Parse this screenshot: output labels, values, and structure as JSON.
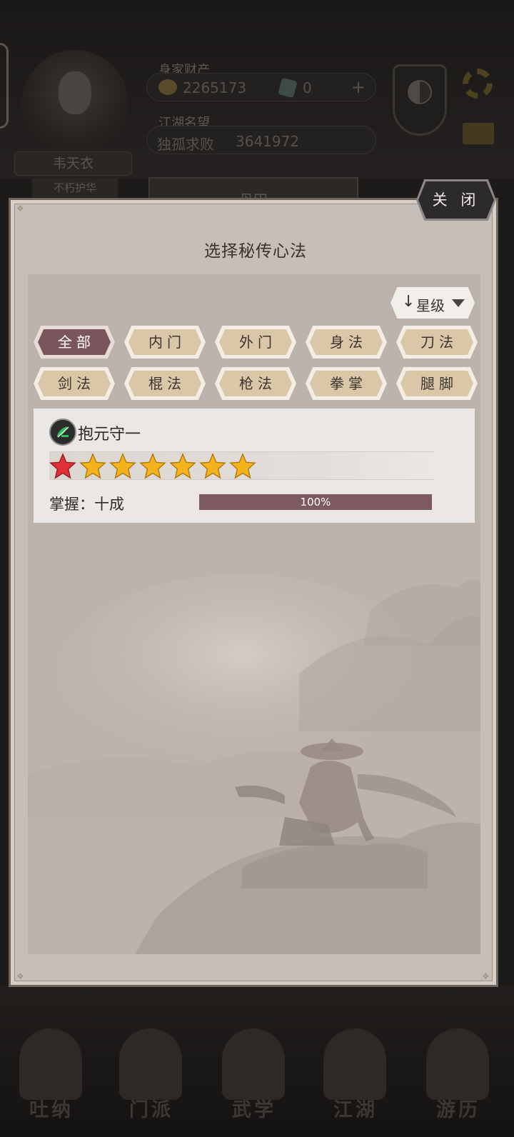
{
  "background": {
    "player": {
      "name": "韦天衣",
      "rank": "不朽护华"
    },
    "assets": {
      "label": "身家财产",
      "gold": "2265173",
      "gems": "0",
      "add_symbol": "+"
    },
    "reputation": {
      "label": "江湖名望",
      "title": "独孤求败",
      "value": "3641972"
    },
    "tab_label": "丹田",
    "nav": [
      {
        "label": "吐纳",
        "icon": "meditation-icon"
      },
      {
        "label": "门派",
        "icon": "sect-icon"
      },
      {
        "label": "武学",
        "icon": "martial-arts-icon"
      },
      {
        "label": "江湖",
        "icon": "jianghu-icon"
      },
      {
        "label": "游历",
        "icon": "travel-icon"
      }
    ]
  },
  "modal": {
    "title": "选择秘传心法",
    "close_label": "关 闭",
    "sort": {
      "arrow": "↓",
      "label": "星级"
    },
    "filters": [
      {
        "label": "全部",
        "active": true
      },
      {
        "label": "内门",
        "active": false
      },
      {
        "label": "外门",
        "active": false
      },
      {
        "label": "身法",
        "active": false
      },
      {
        "label": "刀法",
        "active": false
      },
      {
        "label": "剑法",
        "active": false
      },
      {
        "label": "棍法",
        "active": false
      },
      {
        "label": "枪法",
        "active": false
      },
      {
        "label": "拳掌",
        "active": false
      },
      {
        "label": "腿脚",
        "active": false
      }
    ],
    "skills": [
      {
        "name": "抱元守一",
        "icon": "leaf-skill-icon",
        "stars": {
          "red": 1,
          "gold": 6
        },
        "mastery_label": "掌握：十成",
        "mastery_percent": 100,
        "mastery_text": "100%"
      }
    ]
  },
  "colors": {
    "active_chip": "#7b555c",
    "inactive_chip": "#d9c7a8",
    "progress_fill": "#7d5a60",
    "star_gold": "#f4b21c",
    "star_red": "#e0303a"
  }
}
